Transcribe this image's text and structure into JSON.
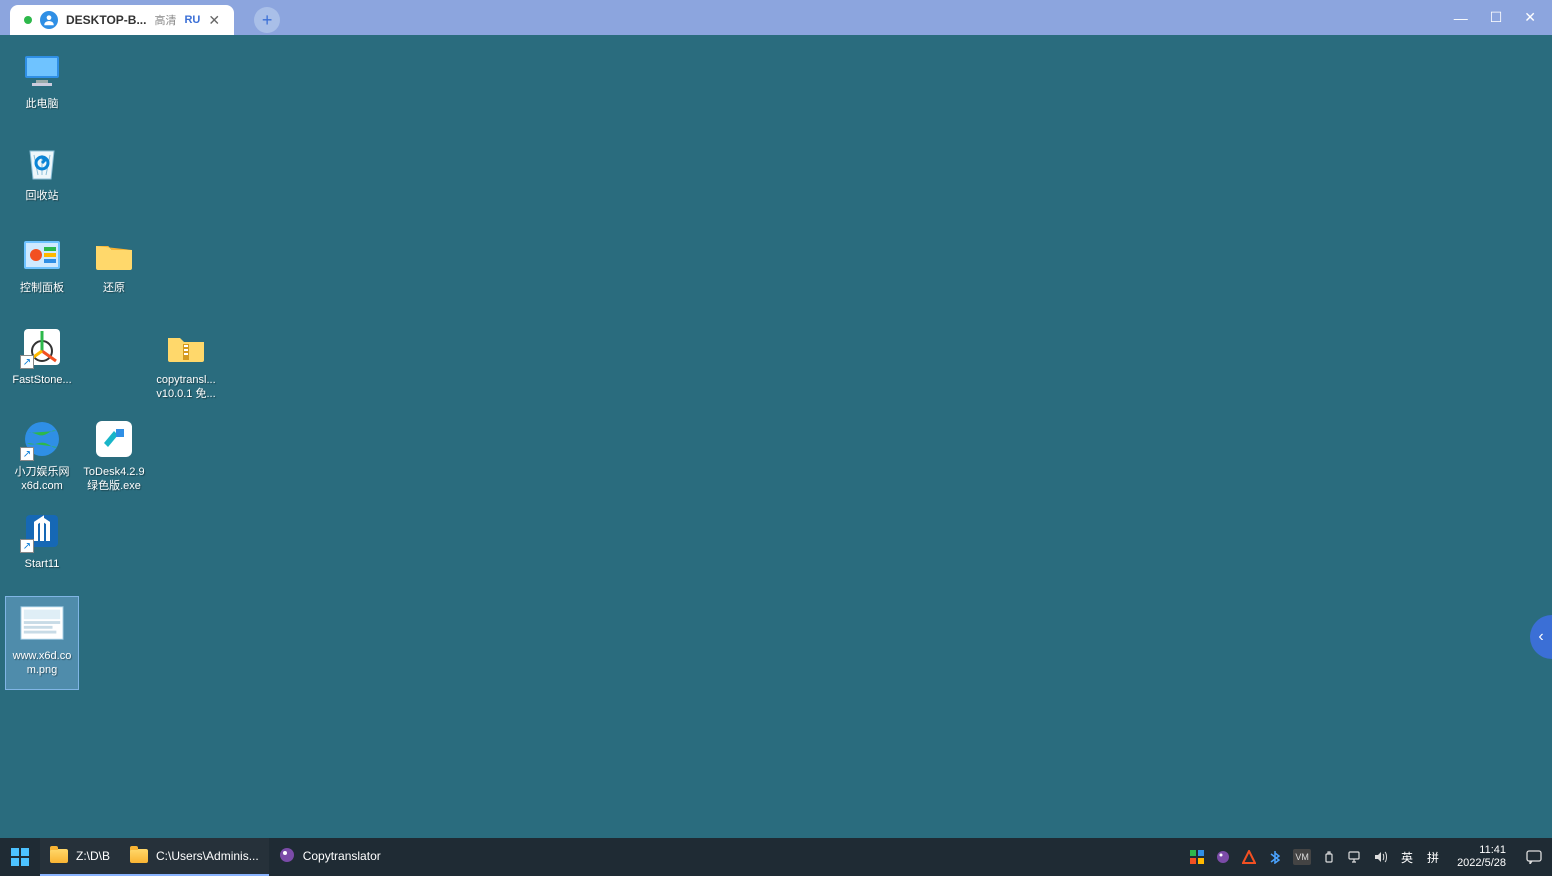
{
  "topbar": {
    "tab_title": "DESKTOP-B...",
    "quality": "高清",
    "marker": "RU",
    "close": "✕",
    "plus": "+",
    "min": "—",
    "max": "☐",
    "cls": "✕"
  },
  "pull": {
    "a": "—",
    "b": "⌄"
  },
  "desktop_icons": [
    {
      "id": "this-pc",
      "label": "此电脑",
      "col": 1,
      "row": 1,
      "kind": "pc"
    },
    {
      "id": "recycle",
      "label": "回收站",
      "col": 1,
      "row": 2,
      "kind": "recycle"
    },
    {
      "id": "control-panel",
      "label": "控制面板",
      "col": 1,
      "row": 3,
      "kind": "cpanel"
    },
    {
      "id": "restore",
      "label": "还原",
      "col": 2,
      "row": 3,
      "kind": "folder"
    },
    {
      "id": "faststone",
      "label": "FastStone...",
      "col": 1,
      "row": 4,
      "kind": "faststone",
      "shortcut": true
    },
    {
      "id": "copytranslator-pkg",
      "label": "copytransl...\nv10.0.1 免...",
      "col": 3,
      "row": 4,
      "kind": "folder-zip"
    },
    {
      "id": "x6d",
      "label": "小刀娱乐网\nx6d.com",
      "col": 1,
      "row": 5,
      "kind": "globe",
      "shortcut": true
    },
    {
      "id": "todesk",
      "label": "ToDesk4.2.9\n绿色版.exe",
      "col": 2,
      "row": 5,
      "kind": "todesk"
    },
    {
      "id": "start11",
      "label": "Start11",
      "col": 1,
      "row": 6,
      "kind": "start11",
      "shortcut": true
    },
    {
      "id": "x6d-png",
      "label": "www.x6d.co\nm.png",
      "col": 1,
      "row": 7,
      "kind": "png",
      "selected": true
    }
  ],
  "sidehandle": "‹",
  "taskbar": {
    "items": [
      {
        "id": "explorer1",
        "label": "Z:\\D\\B",
        "kind": "folder",
        "active": true
      },
      {
        "id": "explorer2",
        "label": "C:\\Users\\Adminis...",
        "kind": "folder",
        "active": true
      },
      {
        "id": "copytranslator",
        "label": "Copytranslator",
        "kind": "ct",
        "active": false
      }
    ],
    "tray": {
      "ime_lang": "英",
      "ime_mode": "拼"
    },
    "time": "11:41",
    "date": "2022/5/28"
  }
}
